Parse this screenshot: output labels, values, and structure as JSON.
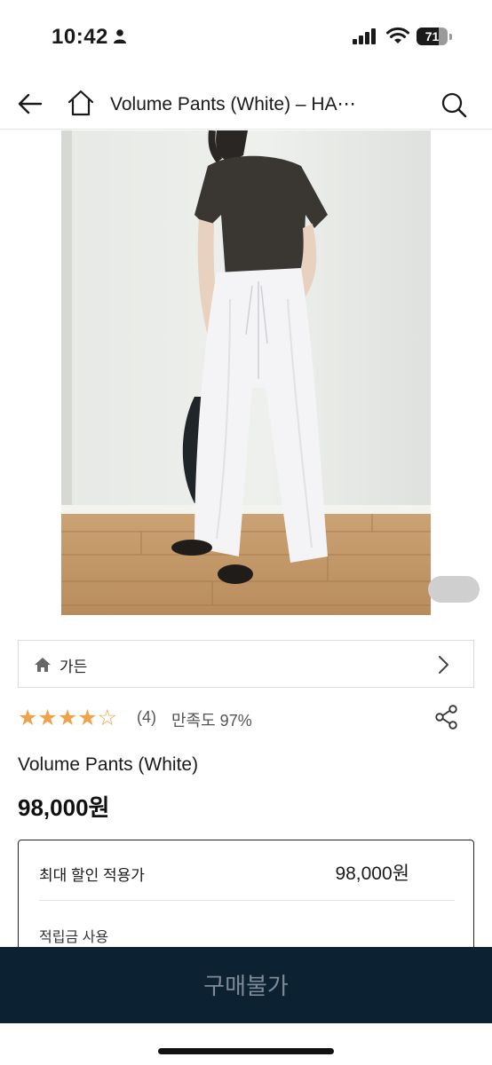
{
  "status_bar": {
    "time": "10:42",
    "battery_percent": "71",
    "battery_level": 0.71
  },
  "nav": {
    "title": "Volume Pants (White) – HA⋯",
    "icons": [
      "back-arrow-icon",
      "home-icon",
      "search-icon"
    ]
  },
  "brand": {
    "name": "가든"
  },
  "rating": {
    "stars_value": 4,
    "stars_max": 5,
    "stars_text": "★★★★☆",
    "review_count": "(4)",
    "satisfaction": "만족도 97%"
  },
  "product": {
    "name": "Volume Pants (White)",
    "price": "98,000원"
  },
  "price_box": {
    "discount_label": "최대 할인 적용가",
    "discount_value": "98,000원",
    "points_label": "적립금 사용"
  },
  "buy_bar": {
    "label": "구매불가",
    "background": "#0c2233"
  },
  "colors": {
    "star": "#f0a24a",
    "buy_bar": "#0c2233"
  }
}
